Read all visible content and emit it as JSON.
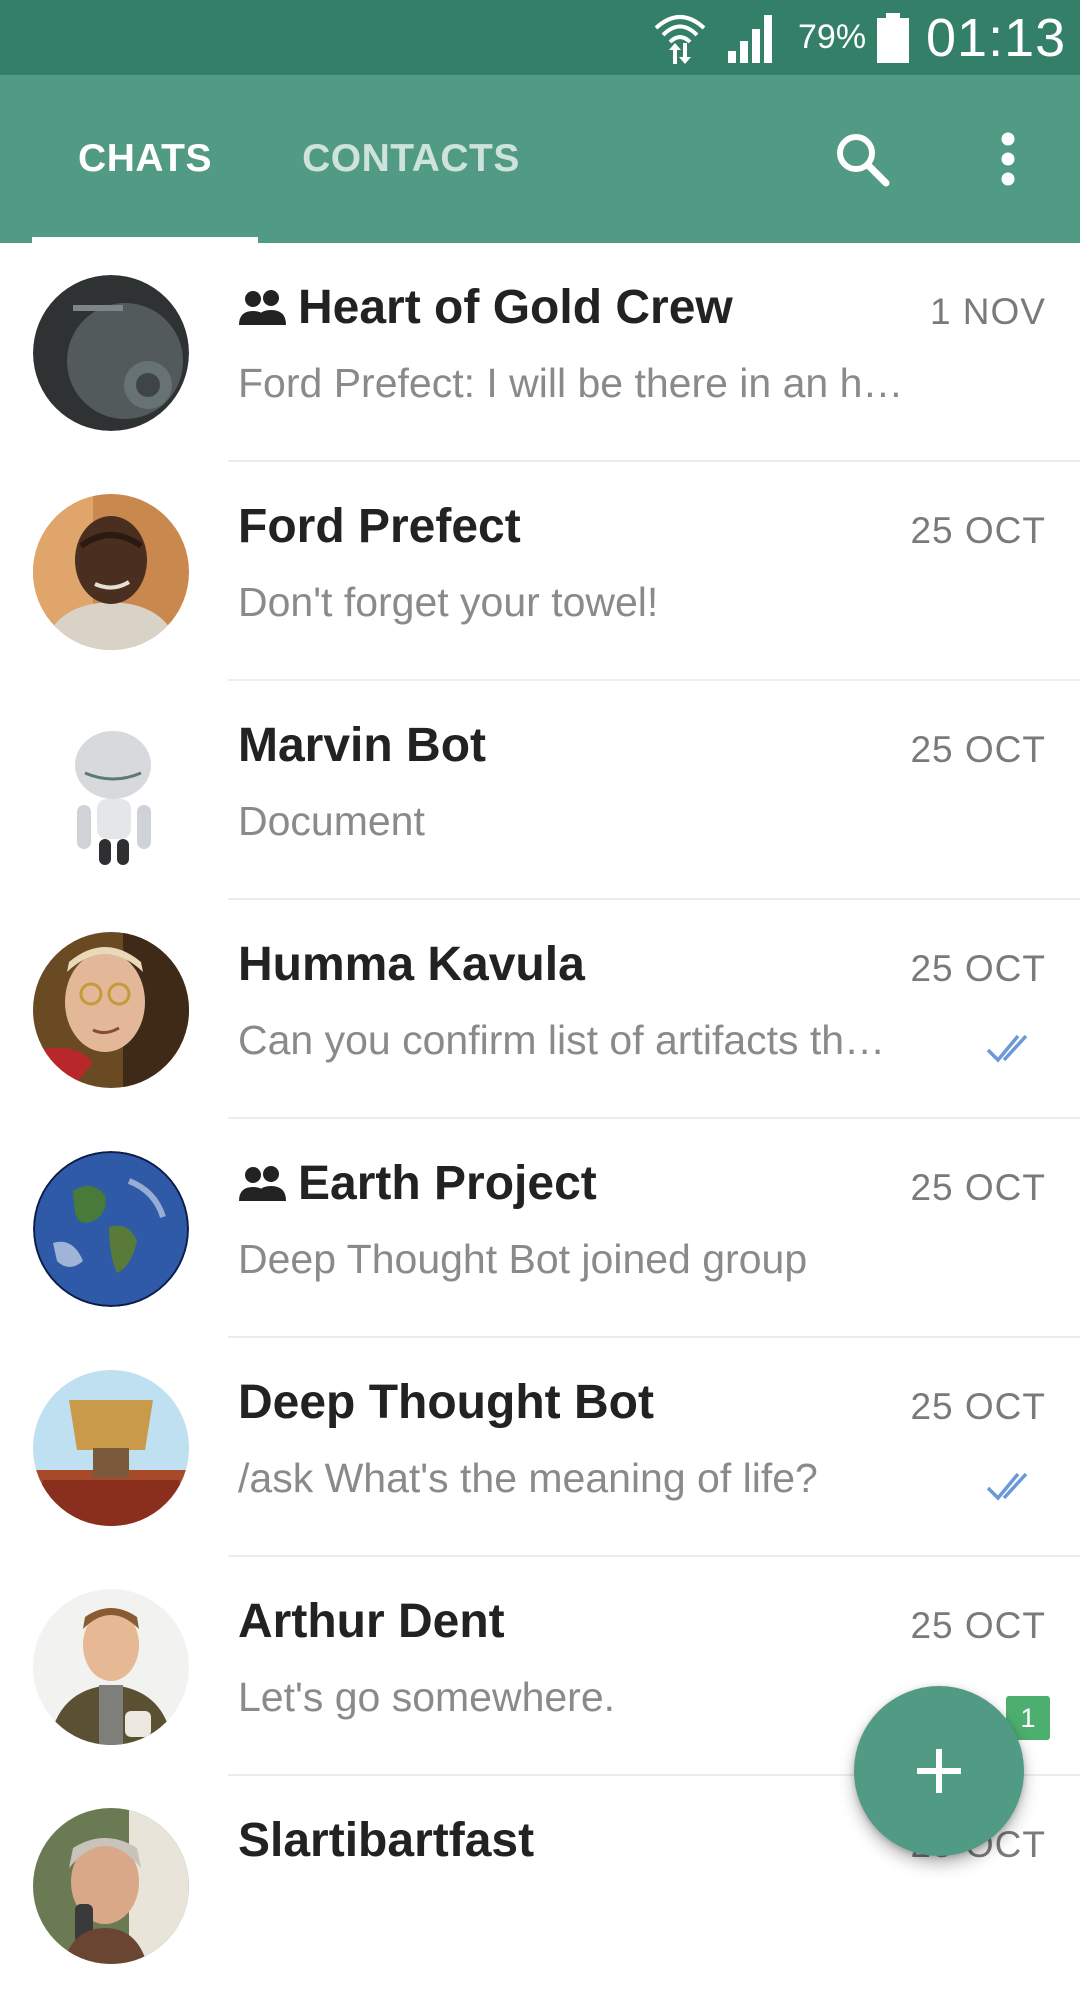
{
  "status_bar": {
    "battery_percent": "79%",
    "time": "01:13",
    "icons": [
      "wifi-icon",
      "signal-icon",
      "battery-icon"
    ]
  },
  "app_bar": {
    "tabs": [
      {
        "label": "CHATS",
        "active": true
      },
      {
        "label": "CONTACTS",
        "active": false
      }
    ],
    "actions": [
      "search-icon",
      "more-vert-icon"
    ]
  },
  "chats": [
    {
      "title": "Heart of Gold Crew",
      "is_group": true,
      "date": "1 NOV",
      "preview": "Ford Prefect: I will be there in an h…",
      "status": "none"
    },
    {
      "title": "Ford Prefect",
      "is_group": false,
      "date": "25 OCT",
      "preview": "Don't forget your towel!",
      "status": "none"
    },
    {
      "title": "Marvin Bot",
      "is_group": false,
      "date": "25 OCT",
      "preview": "Document",
      "status": "none"
    },
    {
      "title": "Humma Kavula",
      "is_group": false,
      "date": "25 OCT",
      "preview": "Can you confirm list of artifacts th…",
      "status": "read"
    },
    {
      "title": "Earth Project",
      "is_group": true,
      "date": "25 OCT",
      "preview": "Deep Thought Bot joined group",
      "status": "none"
    },
    {
      "title": "Deep Thought Bot",
      "is_group": false,
      "date": "25 OCT",
      "preview": "/ask What's the meaning of life?",
      "status": "read"
    },
    {
      "title": "Arthur Dent",
      "is_group": false,
      "date": "25 OCT",
      "preview": "Let's go somewhere.",
      "status": "unread",
      "unread_count": "1"
    },
    {
      "title": "Slartibartfast",
      "is_group": false,
      "date": "25 OCT",
      "preview": "",
      "status": "read"
    }
  ],
  "fab": {
    "icon": "plus-icon"
  },
  "colors": {
    "status_bar": "#337f68",
    "app_bar": "#519a83",
    "read_ticks": "#6b98d8",
    "unread_badge": "#4daf6f"
  }
}
